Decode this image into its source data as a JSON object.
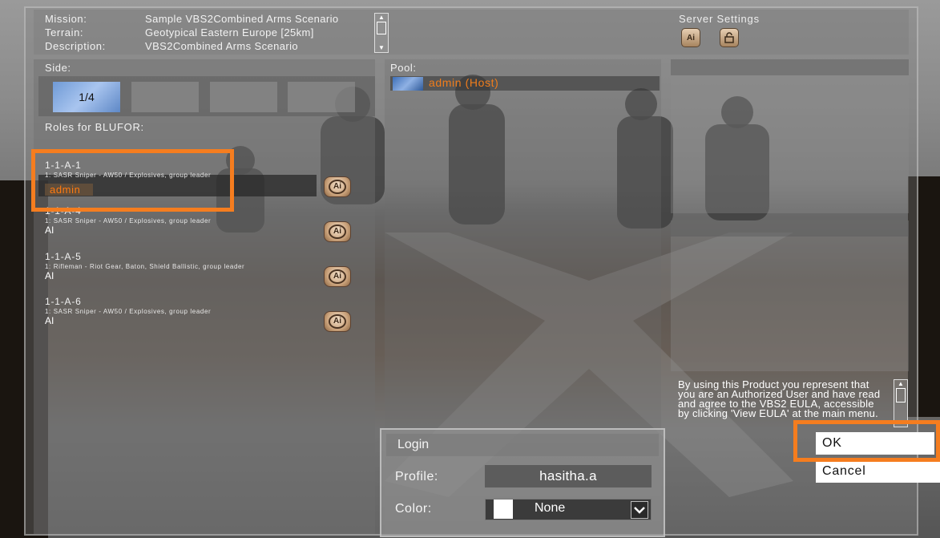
{
  "header": {
    "mission_label": "Mission:",
    "mission_value": "Sample VBS2Combined Arms Scenario",
    "terrain_label": "Terrain:",
    "terrain_value": "Geotypical Eastern Europe [25km]",
    "description_label": "Description:",
    "description_value": "VBS2Combined Arms Scenario"
  },
  "server_settings": {
    "title": "Server Settings",
    "ai_icon": "ai-icon",
    "lock_icon": "lock-icon"
  },
  "side": {
    "title": "Side:",
    "tabs": [
      {
        "label": "1/4",
        "active": true
      },
      {
        "label": "",
        "active": false
      },
      {
        "label": "",
        "active": false
      },
      {
        "label": "",
        "active": false
      }
    ],
    "roles_title": "Roles for BLUFOR:"
  },
  "roles": [
    {
      "name": "1-1-A-1",
      "desc": "1: SASR Sniper - AW50 / Explosives, group leader",
      "player": "admin",
      "selected": true
    },
    {
      "name": "1-1-A-4",
      "desc": "1: SASR Sniper - AW50 / Explosives, group leader",
      "player": "AI"
    },
    {
      "name": "1-1-A-5",
      "desc": "1: Rifleman - Riot Gear, Baton, Shield Ballistic, group leader",
      "player": "AI"
    },
    {
      "name": "1-1-A-6",
      "desc": "1: SASR Sniper - AW50 / Explosives, group leader",
      "player": "AI"
    }
  ],
  "pool": {
    "title": "Pool:",
    "entry": "admin (Host)"
  },
  "eula": {
    "text": "By using this Product you represent that you are an Authorized User and have read and agree to the VBS2 EULA, accessible by clicking 'View EULA' at the main menu."
  },
  "login": {
    "title": "Login",
    "profile_label": "Profile:",
    "profile_value": "hasitha.a",
    "color_label": "Color:",
    "color_value": "None",
    "swatch_color": "#ffffff"
  },
  "buttons": {
    "ok": "OK",
    "cancel": "Cancel"
  },
  "ai_label": "Ai",
  "colors": {
    "highlight": "#f57d1f",
    "player_orange": "#f07d1c"
  }
}
